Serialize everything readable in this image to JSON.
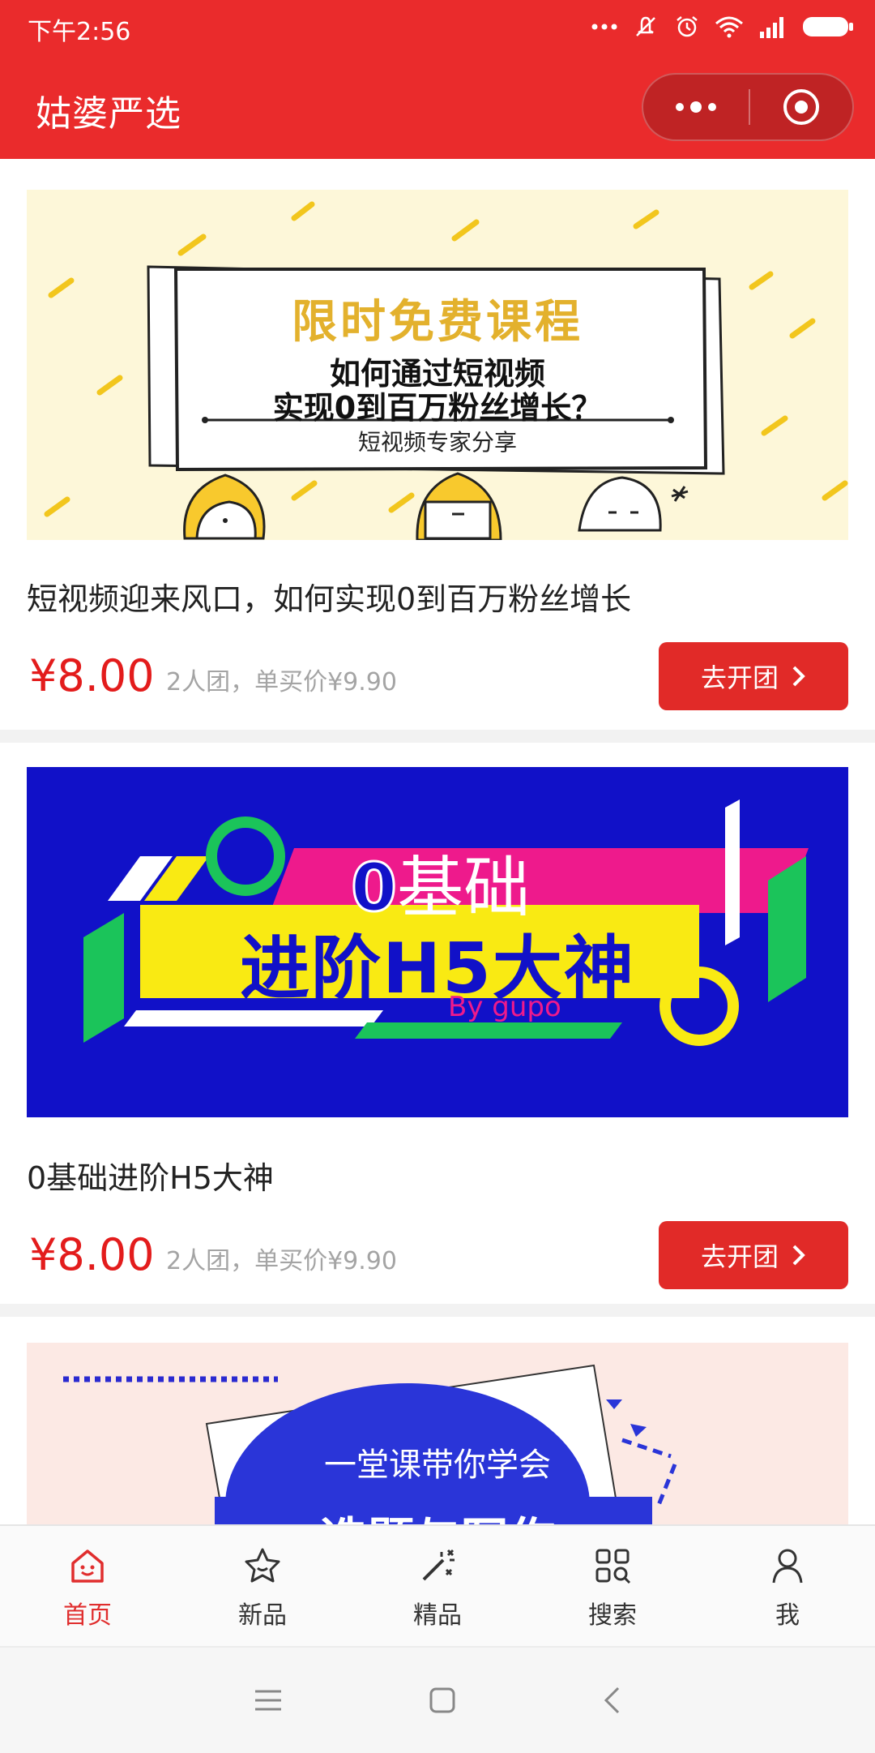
{
  "status": {
    "time": "下午2:56",
    "icons": [
      "more-dots-icon",
      "mute-icon",
      "alarm-icon",
      "wifi-icon",
      "signal-icon",
      "battery-icon"
    ]
  },
  "header": {
    "title": "姑婆严选"
  },
  "products": [
    {
      "banner": {
        "headline": "限时免费课程",
        "line1": "如何通过短视频",
        "line2": "实现0到百万粉丝增长？",
        "caption": "短视频专家分享"
      },
      "title": "短视频迎来风口，如何实现0到百万粉丝增长",
      "price": "¥8.00",
      "price_sub": "2人团，单买价¥9.90",
      "button": "去开团"
    },
    {
      "banner": {
        "zero": "0",
        "jichu": "基础",
        "main": "进阶H5大神",
        "by": "By gupo"
      },
      "title": "0基础进阶H5大神",
      "price": "¥8.00",
      "price_sub": "2人团，单买价¥9.90",
      "button": "去开团"
    },
    {
      "banner": {
        "line1": "一堂课带你学会",
        "line2": "选题与写作"
      }
    }
  ],
  "tabbar": {
    "items": [
      {
        "label": "首页",
        "icon": "home-icon",
        "active": true
      },
      {
        "label": "新品",
        "icon": "star-icon",
        "active": false
      },
      {
        "label": "精品",
        "icon": "magic-wand-icon",
        "active": false
      },
      {
        "label": "搜索",
        "icon": "search-grid-icon",
        "active": false
      },
      {
        "label": "我",
        "icon": "user-icon",
        "active": false
      }
    ]
  },
  "colors": {
    "brand_red": "#ea2b2c",
    "price_red": "#e31c1c",
    "button_red": "#e12a28",
    "banner1_bg": "#fdf7d9",
    "banner2_bg": "#1111c8",
    "banner3_bg": "#fce9e4"
  }
}
